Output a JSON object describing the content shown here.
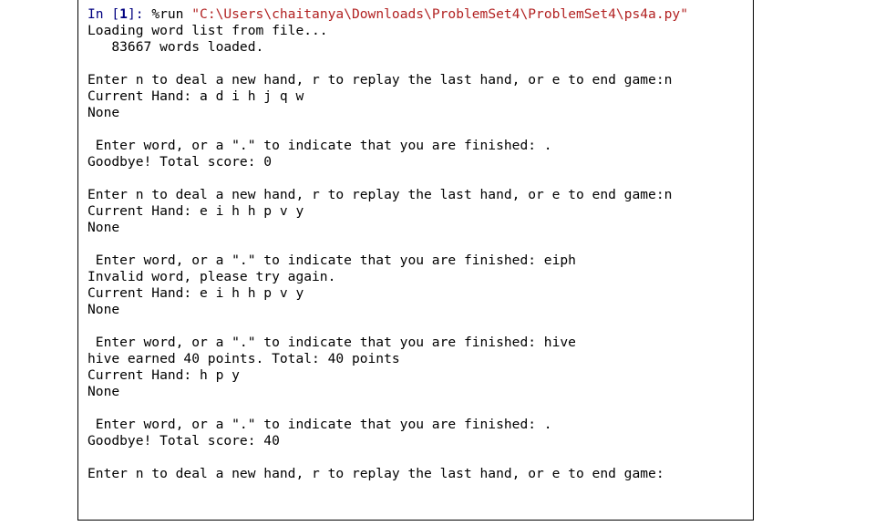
{
  "prompt": {
    "prefix": "In [",
    "number": "1",
    "suffix": "]: ",
    "magic": "%run ",
    "path": "\"C:\\Users\\chaitanya\\Downloads\\ProblemSet4\\ProblemSet4\\ps4a.py\""
  },
  "output_lines": [
    "Loading word list from file...",
    "   83667 words loaded.",
    "",
    "Enter n to deal a new hand, r to replay the last hand, or e to end game:n",
    "Current Hand: a d i h j q w",
    "None",
    "",
    " Enter word, or a \".\" to indicate that you are finished: .",
    "Goodbye! Total score: 0",
    "",
    "Enter n to deal a new hand, r to replay the last hand, or e to end game:n",
    "Current Hand: e i h h p v y",
    "None",
    "",
    " Enter word, or a \".\" to indicate that you are finished: eiph",
    "Invalid word, please try again.",
    "Current Hand: e i h h p v y",
    "None",
    "",
    " Enter word, or a \".\" to indicate that you are finished: hive",
    "hive earned 40 points. Total: 40 points",
    "Current Hand: h p y",
    "None",
    "",
    " Enter word, or a \".\" to indicate that you are finished: .",
    "Goodbye! Total score: 40",
    "",
    "Enter n to deal a new hand, r to replay the last hand, or e to end game:"
  ]
}
